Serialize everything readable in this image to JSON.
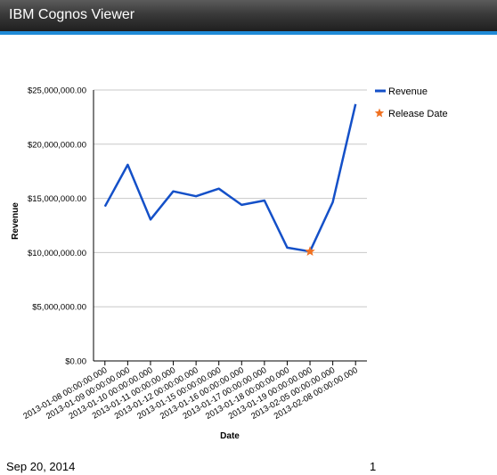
{
  "window": {
    "title": "IBM Cognos Viewer"
  },
  "footer": {
    "date": "Sep 20, 2014",
    "page_number": "1"
  },
  "chart_data": {
    "type": "line",
    "title": "",
    "xlabel": "Date",
    "ylabel": "Revenue",
    "ylim": [
      0,
      25000000
    ],
    "y_ticks": [
      "$0.00",
      "$5,000,000.00",
      "$10,000,000.00",
      "$15,000,000.00",
      "$20,000,000.00",
      "$25,000,000.00"
    ],
    "y_tick_values": [
      0,
      5000000,
      10000000,
      15000000,
      20000000,
      25000000
    ],
    "grid": true,
    "legend_position": "right",
    "categories": [
      "2013-01-08 00:00:00.000",
      "2013-01-09 00:00:00.000",
      "2013-01-10 00:00:00.000",
      "2013-01-11 00:00:00.000",
      "2013-01-12 00:00:00.000",
      "2013-01-15 00:00:00.000",
      "2013-01-16 00:00:00.000",
      "2013-01-17 00:00:00.000",
      "2013-01-18 00:00:00.000",
      "2013-01-19 00:00:00.000",
      "2013-02-05 00:00:00.000",
      "2013-02-08 00:00:00.000"
    ],
    "series": [
      {
        "name": "Revenue",
        "color": "#1450c8",
        "values": [
          14250000,
          18100000,
          13050000,
          15650000,
          15200000,
          15900000,
          14400000,
          14800000,
          10450000,
          10100000,
          14650000,
          23700000
        ]
      }
    ],
    "markers": [
      {
        "name": "Release Date",
        "category": "2013-01-19 00:00:00.000",
        "value": 10100000,
        "color": "#f07020",
        "icon": "star-icon"
      }
    ]
  }
}
